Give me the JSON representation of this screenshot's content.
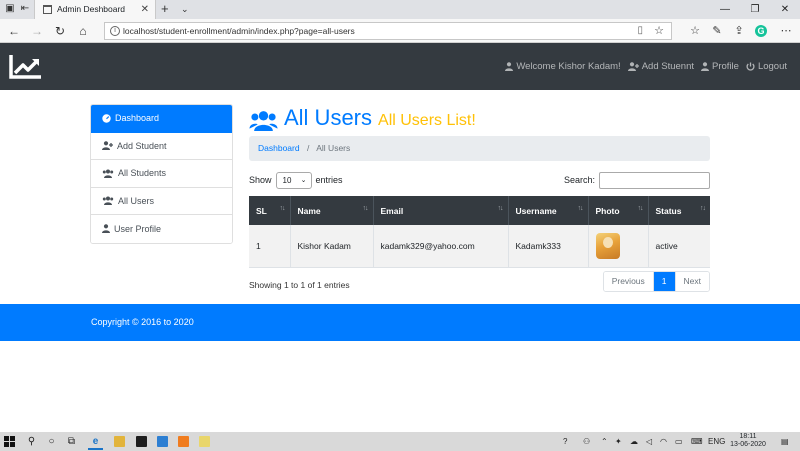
{
  "browser": {
    "tab_title": "Admin Deshboard",
    "tab_close": "✕",
    "new_tab": "+",
    "address": "localhost/student-enrollment/admin/index.php?page=all-users"
  },
  "navbar": {
    "welcome": "Welcome Kishor Kadam!",
    "add_student": "Add Stuennt",
    "profile": "Profile",
    "logout": "Logout"
  },
  "sidebar": {
    "items": [
      {
        "label": "Dashboard",
        "icon": "gauge-icon",
        "active": true
      },
      {
        "label": "Add Student",
        "icon": "user-plus-icon"
      },
      {
        "label": "All Students",
        "icon": "users-icon"
      },
      {
        "label": "All Users",
        "icon": "users-icon"
      },
      {
        "label": "User Profile",
        "icon": "user-icon"
      }
    ]
  },
  "main": {
    "title": "All Users",
    "subtitle": "All Users List!",
    "breadcrumb": {
      "link": "Dashboard",
      "separator": "/",
      "current": "All Users"
    },
    "show_label": "Show",
    "entries_value": "10",
    "entries_label": "entries",
    "search_label": "Search:",
    "table": {
      "columns": [
        "SL",
        "Name",
        "Email",
        "Username",
        "Photo",
        "Status"
      ],
      "rows": [
        {
          "sl": "1",
          "name": "Kishor Kadam",
          "email": "kadamk329@yahoo.com",
          "username": "Kadamk333",
          "status": "active"
        }
      ]
    },
    "showing": "Showing 1 to 1 of 1 entries",
    "pagination": {
      "previous": "Previous",
      "page": "1",
      "next": "Next"
    }
  },
  "footer": {
    "text": "Copyright © 2016 to 2020"
  },
  "taskbar": {
    "lang": "ENG",
    "time": "18:11",
    "date": "13-06-2020"
  },
  "colors": {
    "primary": "#007bff",
    "dark": "#343a40",
    "warning": "#ffc107"
  }
}
